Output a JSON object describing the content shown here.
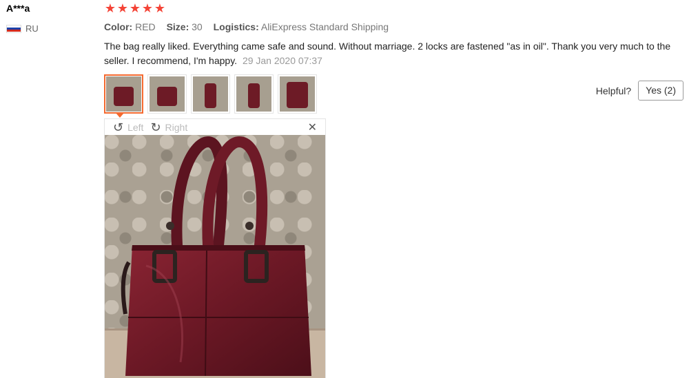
{
  "user": {
    "name": "A***a",
    "country": "RU",
    "flag_colors": [
      "#ffffff",
      "#1c3fa8",
      "#d52b1e"
    ]
  },
  "review": {
    "rating": 5,
    "star_color": "#f44336",
    "attributes": [
      {
        "key": "Color:",
        "value": "RED"
      },
      {
        "key": "Size:",
        "value": "30"
      },
      {
        "key": "Logistics:",
        "value": "AliExpress Standard Shipping"
      }
    ],
    "text": "The bag really liked. Everything came safe and sound. Without marriage. 2 locks are fastened \"as in oil\". Thank you very much to the seller. I recommend, I'm happy.",
    "date": "29 Jan 2020 07:37",
    "thumbnail_count": 5,
    "active_thumbnail": 0,
    "accent_color": "#f4692f"
  },
  "helpful": {
    "label": "Helpful?",
    "yes_label": "Yes (2)"
  },
  "viewer": {
    "rotate_left_label": "Left",
    "rotate_right_label": "Right",
    "rotate_left_icon": "rotate-left-icon",
    "rotate_right_icon": "rotate-right-icon",
    "close_icon": "close-icon",
    "photo_subject": "burgundy leather tote bag"
  }
}
